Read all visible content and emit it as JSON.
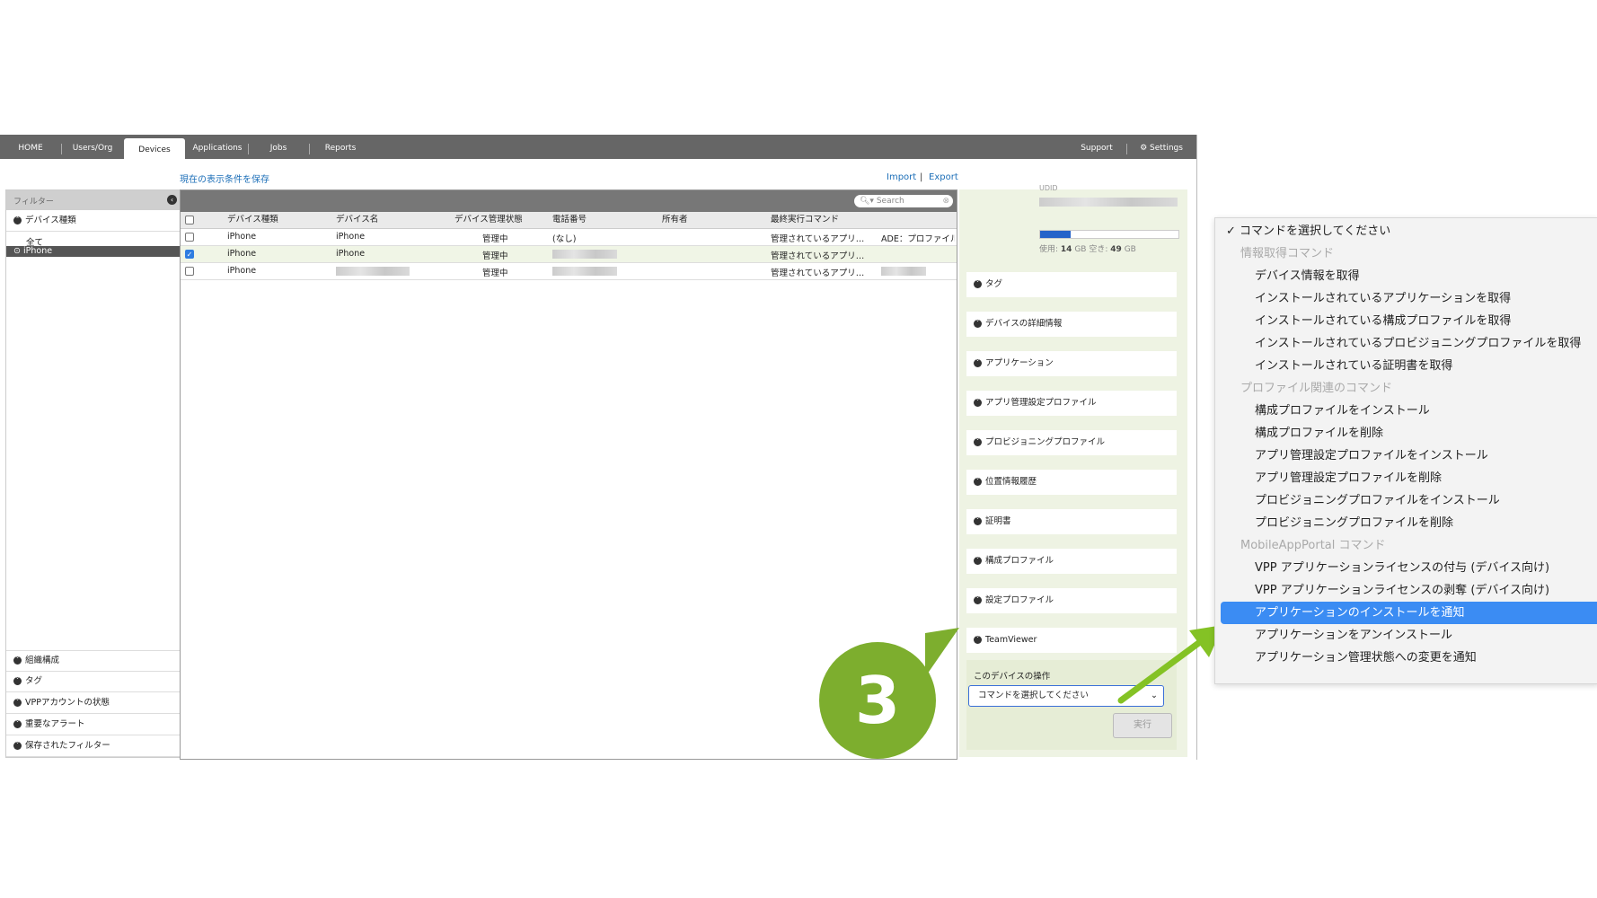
{
  "nav": {
    "tabs": [
      "HOME",
      "Users/Org",
      "Devices",
      "Applications",
      "Jobs",
      "Reports"
    ],
    "active": "Devices",
    "support": "Support",
    "settings": "Settings"
  },
  "toolbar": {
    "save_view": "現在の表示条件を保存",
    "import": "Import",
    "separator": "|",
    "export": "Export"
  },
  "sidebar": {
    "title": "フィルター",
    "device_type": "デバイス種類",
    "all": "全て",
    "iphone": "iPhone",
    "bottom": [
      "組織構成",
      "タグ",
      "VPPアカウントの状態",
      "重要なアラート",
      "保存されたフィルター"
    ]
  },
  "table": {
    "search_placeholder": "Search",
    "headers": [
      "デバイス種類",
      "デバイス名",
      "デバイス管理状態",
      "電話番号",
      "所有者",
      "最終実行コマンド"
    ],
    "rows": [
      {
        "type": "iPhone",
        "name": "iPhone",
        "status": "管理中",
        "phone": "(なし)",
        "command": "管理されているアプリ…",
        "extra": "ADE：プロファイル",
        "checked": false
      },
      {
        "type": "iPhone",
        "name": "iPhone",
        "status": "管理中",
        "phone": "",
        "command": "管理されているアプリ…",
        "extra": "",
        "checked": true
      },
      {
        "type": "iPhone",
        "name": "",
        "status": "管理中",
        "phone": "",
        "command": "管理されているアプリ…",
        "extra": "",
        "checked": false
      }
    ]
  },
  "panel": {
    "udid_label": "UDID",
    "storage": {
      "used_label": "使用:",
      "used": "14",
      "free_label": "空き:",
      "free": "49",
      "unit": "GB",
      "used_fraction": 0.22
    },
    "sections": [
      "タグ",
      "デバイスの詳細情報",
      "アプリケーション",
      "アプリ管理設定プロファイル",
      "プロビジョニングプロファイル",
      "位置情報履歴",
      "証明書",
      "構成プロファイル",
      "設定プロファイル",
      "TeamViewer"
    ],
    "ops_title": "このデバイスの操作",
    "select_value": "コマンドを選択してください",
    "execute": "実行"
  },
  "menu": {
    "checkmark": "✓",
    "selected": "コマンドを選択してください",
    "items": [
      {
        "label": "情報取得コマンド",
        "group": true
      },
      {
        "label": "デバイス情報を取得"
      },
      {
        "label": "インストールされているアプリケーションを取得"
      },
      {
        "label": "インストールされている構成プロファイルを取得"
      },
      {
        "label": "インストールされているプロビジョニングプロファイルを取得"
      },
      {
        "label": "インストールされている証明書を取得"
      },
      {
        "label": "プロファイル関連のコマンド",
        "group": true
      },
      {
        "label": "構成プロファイルをインストール"
      },
      {
        "label": "構成プロファイルを削除"
      },
      {
        "label": "アプリ管理設定プロファイルをインストール"
      },
      {
        "label": "アプリ管理設定プロファイルを削除"
      },
      {
        "label": "プロビジョニングプロファイルをインストール"
      },
      {
        "label": "プロビジョニングプロファイルを削除"
      },
      {
        "label": "MobileAppPortal コマンド",
        "group": true
      },
      {
        "label": "VPP アプリケーションライセンスの付与 (デバイス向け)"
      },
      {
        "label": "VPP アプリケーションライセンスの剥奪 (デバイス向け)"
      },
      {
        "label": "アプリケーションのインストールを通知",
        "highlighted": true
      },
      {
        "label": "アプリケーションをアンインストール"
      },
      {
        "label": "アプリケーション管理状態への変更を通知"
      }
    ]
  },
  "step_badge": "3",
  "colors": {
    "accent": "#7dae2e",
    "highlight": "#3b8cf3",
    "link": "#1d6fb8",
    "nav": "#666666"
  }
}
